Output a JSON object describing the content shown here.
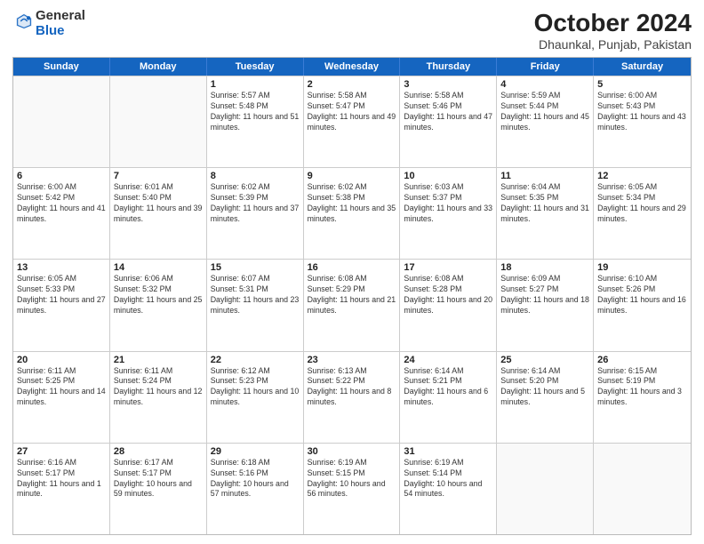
{
  "header": {
    "logo_general": "General",
    "logo_blue": "Blue",
    "month_title": "October 2024",
    "location": "Dhaunkal, Punjab, Pakistan"
  },
  "weekdays": [
    "Sunday",
    "Monday",
    "Tuesday",
    "Wednesday",
    "Thursday",
    "Friday",
    "Saturday"
  ],
  "rows": [
    [
      {
        "day": "",
        "detail": ""
      },
      {
        "day": "",
        "detail": ""
      },
      {
        "day": "1",
        "detail": "Sunrise: 5:57 AM\nSunset: 5:48 PM\nDaylight: 11 hours and 51 minutes."
      },
      {
        "day": "2",
        "detail": "Sunrise: 5:58 AM\nSunset: 5:47 PM\nDaylight: 11 hours and 49 minutes."
      },
      {
        "day": "3",
        "detail": "Sunrise: 5:58 AM\nSunset: 5:46 PM\nDaylight: 11 hours and 47 minutes."
      },
      {
        "day": "4",
        "detail": "Sunrise: 5:59 AM\nSunset: 5:44 PM\nDaylight: 11 hours and 45 minutes."
      },
      {
        "day": "5",
        "detail": "Sunrise: 6:00 AM\nSunset: 5:43 PM\nDaylight: 11 hours and 43 minutes."
      }
    ],
    [
      {
        "day": "6",
        "detail": "Sunrise: 6:00 AM\nSunset: 5:42 PM\nDaylight: 11 hours and 41 minutes."
      },
      {
        "day": "7",
        "detail": "Sunrise: 6:01 AM\nSunset: 5:40 PM\nDaylight: 11 hours and 39 minutes."
      },
      {
        "day": "8",
        "detail": "Sunrise: 6:02 AM\nSunset: 5:39 PM\nDaylight: 11 hours and 37 minutes."
      },
      {
        "day": "9",
        "detail": "Sunrise: 6:02 AM\nSunset: 5:38 PM\nDaylight: 11 hours and 35 minutes."
      },
      {
        "day": "10",
        "detail": "Sunrise: 6:03 AM\nSunset: 5:37 PM\nDaylight: 11 hours and 33 minutes."
      },
      {
        "day": "11",
        "detail": "Sunrise: 6:04 AM\nSunset: 5:35 PM\nDaylight: 11 hours and 31 minutes."
      },
      {
        "day": "12",
        "detail": "Sunrise: 6:05 AM\nSunset: 5:34 PM\nDaylight: 11 hours and 29 minutes."
      }
    ],
    [
      {
        "day": "13",
        "detail": "Sunrise: 6:05 AM\nSunset: 5:33 PM\nDaylight: 11 hours and 27 minutes."
      },
      {
        "day": "14",
        "detail": "Sunrise: 6:06 AM\nSunset: 5:32 PM\nDaylight: 11 hours and 25 minutes."
      },
      {
        "day": "15",
        "detail": "Sunrise: 6:07 AM\nSunset: 5:31 PM\nDaylight: 11 hours and 23 minutes."
      },
      {
        "day": "16",
        "detail": "Sunrise: 6:08 AM\nSunset: 5:29 PM\nDaylight: 11 hours and 21 minutes."
      },
      {
        "day": "17",
        "detail": "Sunrise: 6:08 AM\nSunset: 5:28 PM\nDaylight: 11 hours and 20 minutes."
      },
      {
        "day": "18",
        "detail": "Sunrise: 6:09 AM\nSunset: 5:27 PM\nDaylight: 11 hours and 18 minutes."
      },
      {
        "day": "19",
        "detail": "Sunrise: 6:10 AM\nSunset: 5:26 PM\nDaylight: 11 hours and 16 minutes."
      }
    ],
    [
      {
        "day": "20",
        "detail": "Sunrise: 6:11 AM\nSunset: 5:25 PM\nDaylight: 11 hours and 14 minutes."
      },
      {
        "day": "21",
        "detail": "Sunrise: 6:11 AM\nSunset: 5:24 PM\nDaylight: 11 hours and 12 minutes."
      },
      {
        "day": "22",
        "detail": "Sunrise: 6:12 AM\nSunset: 5:23 PM\nDaylight: 11 hours and 10 minutes."
      },
      {
        "day": "23",
        "detail": "Sunrise: 6:13 AM\nSunset: 5:22 PM\nDaylight: 11 hours and 8 minutes."
      },
      {
        "day": "24",
        "detail": "Sunrise: 6:14 AM\nSunset: 5:21 PM\nDaylight: 11 hours and 6 minutes."
      },
      {
        "day": "25",
        "detail": "Sunrise: 6:14 AM\nSunset: 5:20 PM\nDaylight: 11 hours and 5 minutes."
      },
      {
        "day": "26",
        "detail": "Sunrise: 6:15 AM\nSunset: 5:19 PM\nDaylight: 11 hours and 3 minutes."
      }
    ],
    [
      {
        "day": "27",
        "detail": "Sunrise: 6:16 AM\nSunset: 5:17 PM\nDaylight: 11 hours and 1 minute."
      },
      {
        "day": "28",
        "detail": "Sunrise: 6:17 AM\nSunset: 5:17 PM\nDaylight: 10 hours and 59 minutes."
      },
      {
        "day": "29",
        "detail": "Sunrise: 6:18 AM\nSunset: 5:16 PM\nDaylight: 10 hours and 57 minutes."
      },
      {
        "day": "30",
        "detail": "Sunrise: 6:19 AM\nSunset: 5:15 PM\nDaylight: 10 hours and 56 minutes."
      },
      {
        "day": "31",
        "detail": "Sunrise: 6:19 AM\nSunset: 5:14 PM\nDaylight: 10 hours and 54 minutes."
      },
      {
        "day": "",
        "detail": ""
      },
      {
        "day": "",
        "detail": ""
      }
    ]
  ]
}
